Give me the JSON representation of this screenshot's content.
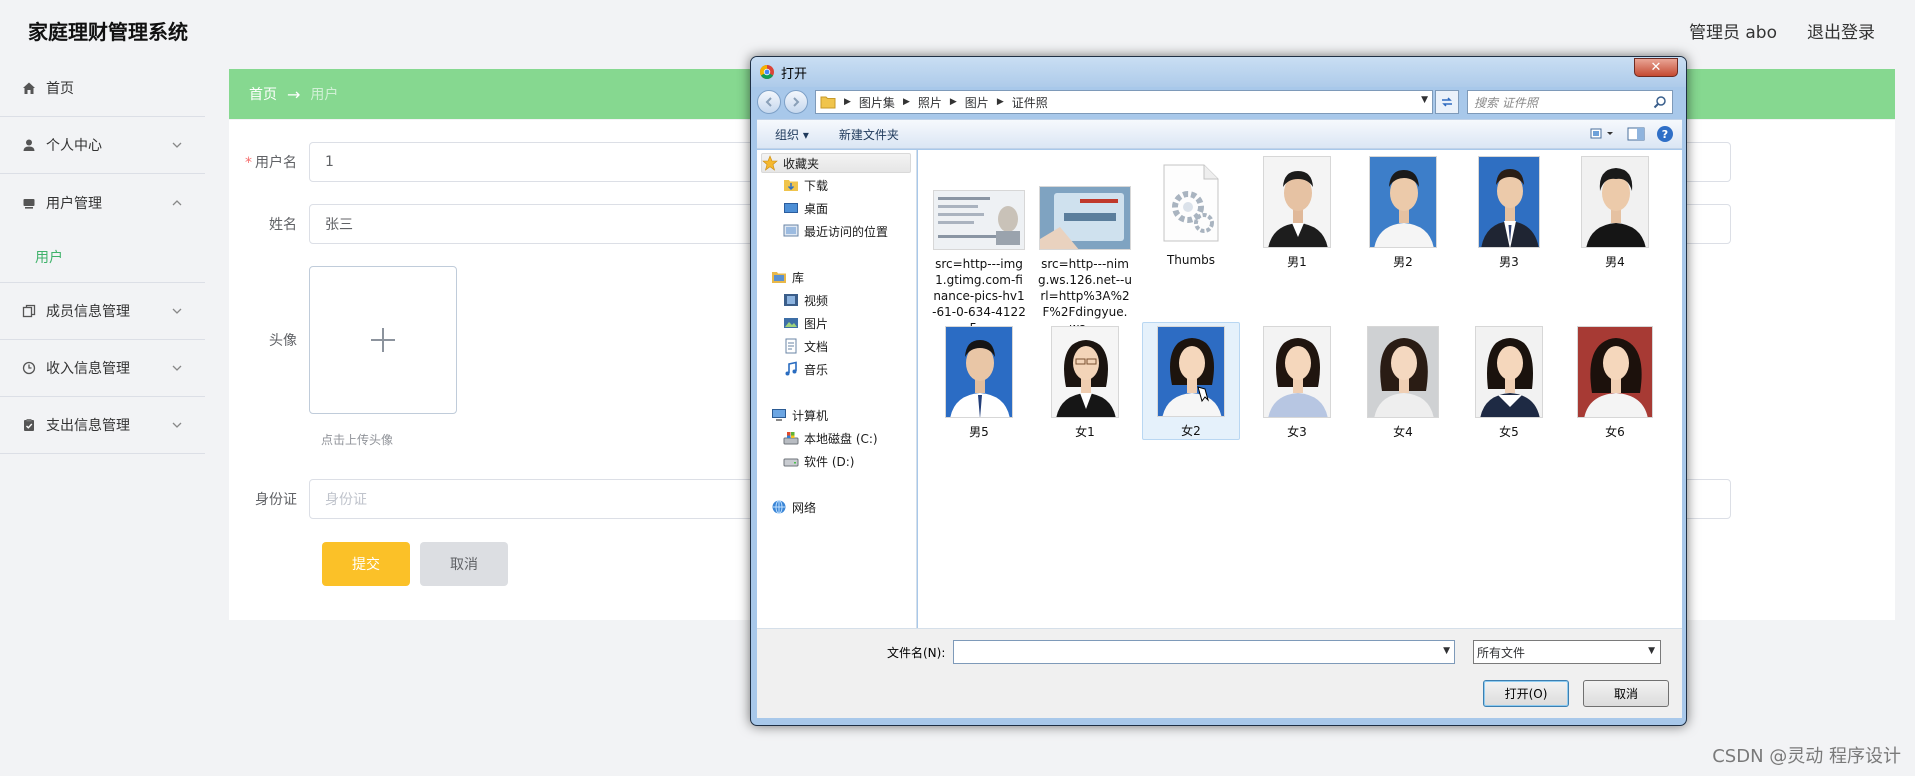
{
  "app": {
    "title": "家庭理财管理系统",
    "user_label": "管理员 abo",
    "logout_label": "退出登录"
  },
  "sidebar": {
    "items": [
      {
        "label": "首页"
      },
      {
        "label": "个人中心"
      },
      {
        "label": "用户管理",
        "sub": "用户"
      },
      {
        "label": "成员信息管理"
      },
      {
        "label": "收入信息管理"
      },
      {
        "label": "支出信息管理"
      }
    ]
  },
  "breadcrumb": {
    "home": "首页",
    "current": "用户"
  },
  "form": {
    "username_label": "用户名",
    "username_value": "1",
    "name_label": "姓名",
    "name_value": "张三",
    "avatar_label": "头像",
    "avatar_tip": "点击上传头像",
    "id_label": "身份证",
    "id_placeholder": "身份证",
    "submit_label": "提交",
    "cancel_label": "取消"
  },
  "watermark": "CSDN @灵动 程序设计",
  "dialog": {
    "title": "打开",
    "close_glyph": "✕",
    "path": [
      "图片集",
      "照片",
      "图片",
      "证件照"
    ],
    "search_placeholder": "搜索 证件照",
    "toolbar": {
      "organize": "组织 ▾",
      "new_folder": "新建文件夹"
    },
    "tree": {
      "favorites": "收藏夹",
      "downloads": "下载",
      "desktop": "桌面",
      "recent": "最近访问的位置",
      "libraries": "库",
      "videos": "视频",
      "pictures": "图片",
      "documents": "文档",
      "music": "音乐",
      "computer": "计算机",
      "drive_c": "本地磁盘 (C:)",
      "drive_d": "软件 (D:)",
      "network": "网络"
    },
    "files": [
      {
        "name": "src=http---img1.gtimg.com-finance-pics-hv1-61-0-634-41225..."
      },
      {
        "name": "src=http---nimg.ws.126.net--url=http%3A%2F%2Fdingyue.ws...."
      },
      {
        "name": "Thumbs"
      },
      {
        "name": "男1"
      },
      {
        "name": "男2"
      },
      {
        "name": "男3"
      },
      {
        "name": "男4"
      },
      {
        "name": "男5"
      },
      {
        "name": "女1"
      },
      {
        "name": "女2"
      },
      {
        "name": "女3"
      },
      {
        "name": "女4"
      },
      {
        "name": "女5"
      },
      {
        "name": "女6"
      }
    ],
    "filename_label": "文件名(N):",
    "filename_value": "",
    "filetype_value": "所有文件",
    "open_label": "打开(O)",
    "cancel_label": "取消"
  }
}
